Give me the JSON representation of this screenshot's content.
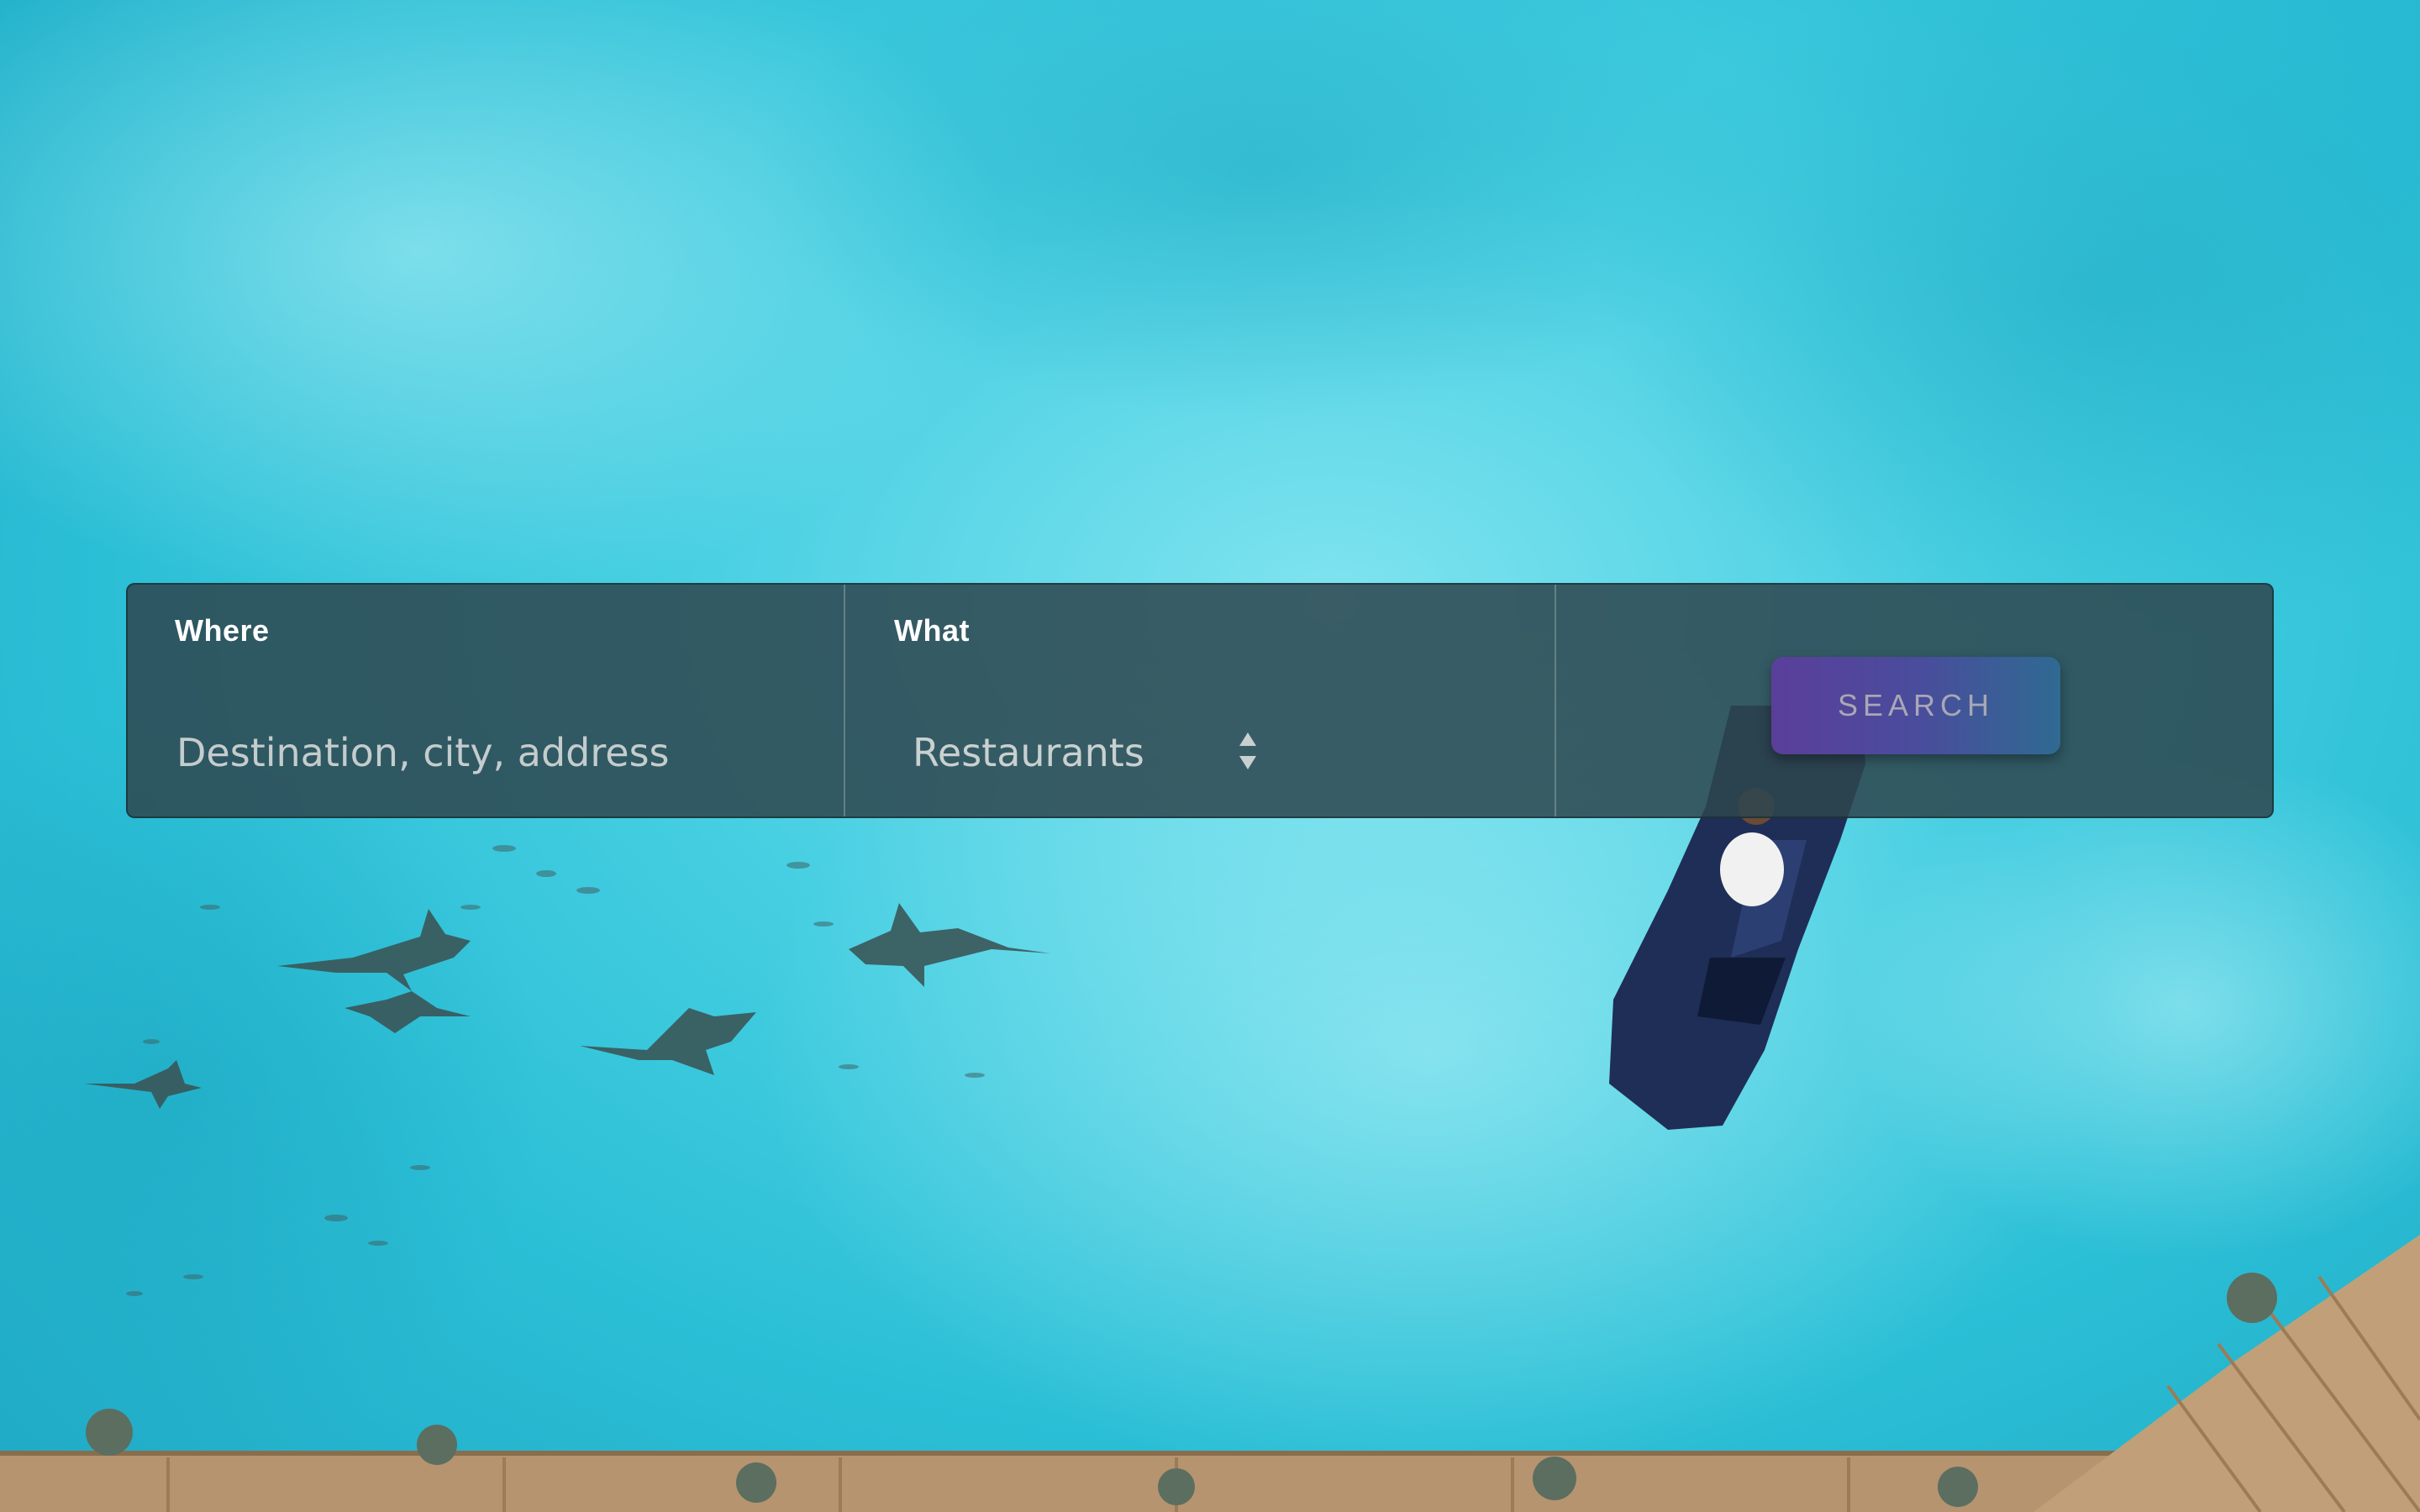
{
  "search": {
    "where": {
      "label": "Where",
      "placeholder": "Destination, city, address",
      "value": ""
    },
    "what": {
      "label": "What",
      "selected": "Restaurants",
      "icon": "up-down-arrows-icon"
    },
    "button_label": "SEARCH"
  },
  "background": {
    "subject": "aerial ocean scene",
    "colors": {
      "water": "#47cfe2",
      "panel": "#2d464e",
      "button_start": "#5a3f9a",
      "button_end": "#2f6a92"
    }
  }
}
